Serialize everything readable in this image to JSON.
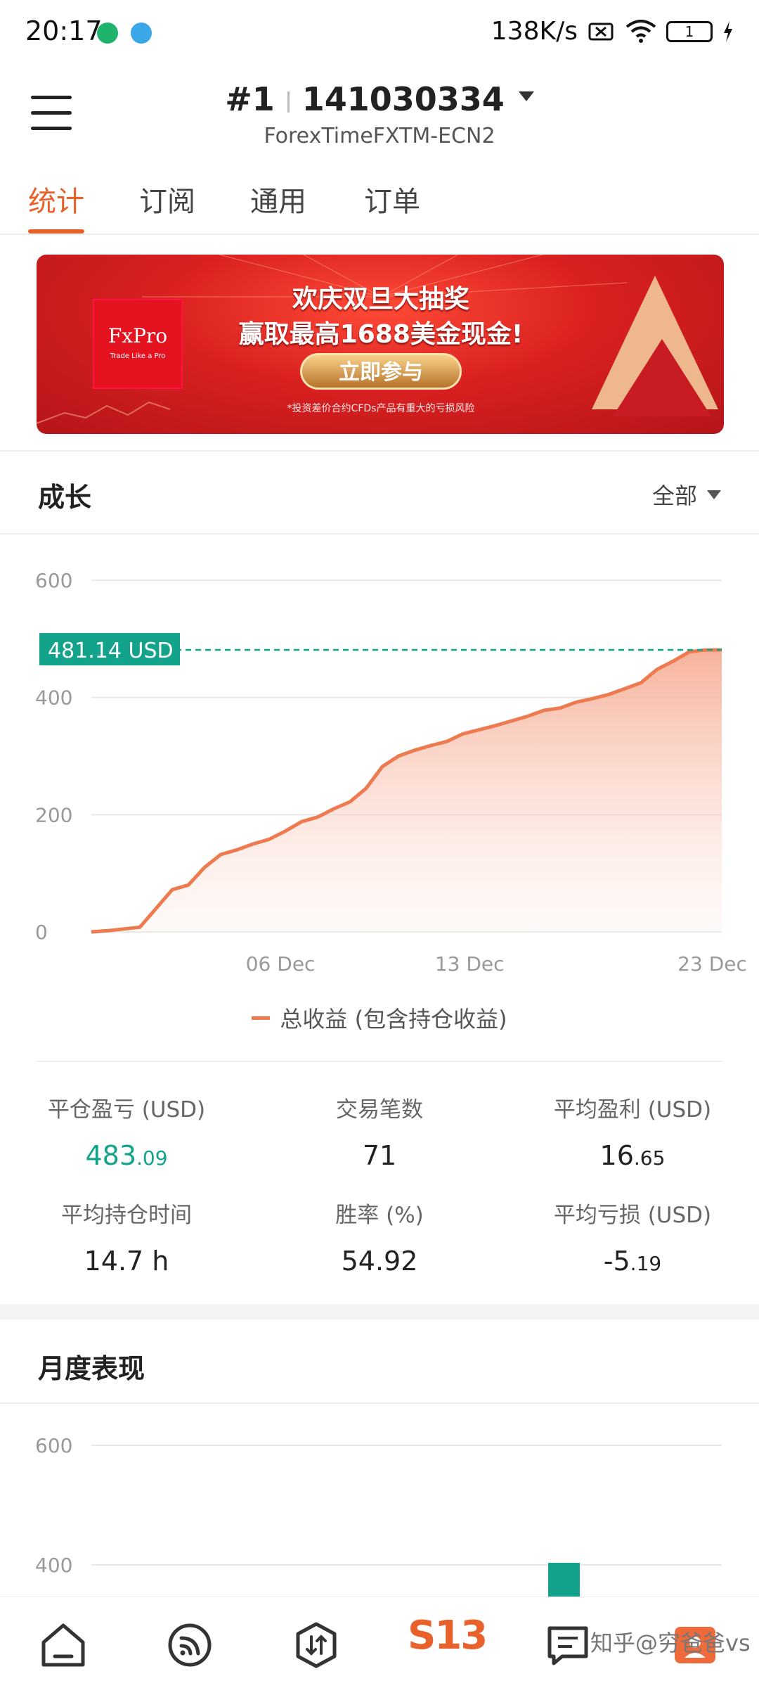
{
  "status_bar": {
    "time": "20:17",
    "speed": "138K/s",
    "battery": "1"
  },
  "header": {
    "account_prefix": "#1",
    "account_number": "141030334",
    "server": "ForexTimeFXTM-ECN2"
  },
  "tabs": [
    {
      "label": "统计",
      "active": true
    },
    {
      "label": "订阅",
      "active": false
    },
    {
      "label": "通用",
      "active": false
    },
    {
      "label": "订单",
      "active": false
    }
  ],
  "banner": {
    "logo_text": "FxPro",
    "logo_sub": "Trade Like a Pro",
    "line1": "欢庆双旦大抽奖",
    "line2": "赢取最高1688美金现金!",
    "button": "立即参与",
    "risk": "*投资差价合约CFDs产品有重大的亏损风险"
  },
  "growth": {
    "title": "成长",
    "filter": "全部",
    "legend": "总收益 (包含持仓收益)"
  },
  "chart_data": [
    {
      "type": "area",
      "ylim": [
        0,
        600
      ],
      "y_ticks": [
        "600",
        "400",
        "200",
        "0"
      ],
      "x_ticks": [
        "06 Dec",
        "13 Dec",
        "23 Dec"
      ],
      "current_value_label": "481.14 USD",
      "current_value": 481.14,
      "series": [
        {
          "name": "总收益 (包含持仓收益)",
          "values": [
            0,
            2,
            5,
            8,
            40,
            72,
            80,
            110,
            132,
            140,
            150,
            158,
            172,
            188,
            196,
            210,
            222,
            245,
            282,
            300,
            310,
            318,
            325,
            338,
            345,
            352,
            360,
            368,
            378,
            382,
            392,
            398,
            405,
            415,
            425,
            448,
            462,
            478,
            481,
            481.14
          ]
        }
      ],
      "color": "#ee7a50"
    },
    {
      "type": "bar",
      "title": "月度表现",
      "ylim": [
        360,
        600
      ],
      "y_ticks": [
        "600",
        "400"
      ],
      "visible_bar_color": "#13a38a"
    }
  ],
  "stats": [
    {
      "label": "平仓盈亏 (USD)",
      "value_int": "483",
      "value_dec": ".09",
      "green": true
    },
    {
      "label": "交易笔数",
      "value_int": "71",
      "value_dec": "",
      "green": false
    },
    {
      "label": "平均盈利 (USD)",
      "value_int": "16",
      "value_dec": ".65",
      "green": false
    },
    {
      "label": "平均持仓时间",
      "value_int": "14.7 h",
      "value_dec": "",
      "green": false
    },
    {
      "label": "胜率 (%)",
      "value_int": "54.92",
      "value_dec": "",
      "green": false
    },
    {
      "label": "平均亏损 (USD)",
      "value_int": "-5",
      "value_dec": ".19",
      "green": false
    }
  ],
  "monthly": {
    "title": "月度表现"
  },
  "bottom_nav": {
    "center_label": "S13",
    "watermark": "知乎@穷爸爸vs",
    "icons": [
      "home-icon",
      "signal-icon",
      "trade-icon",
      "s13-logo",
      "chat-icon",
      "profile-icon"
    ]
  },
  "colors": {
    "accent": "#e8612a",
    "green": "#13a38a"
  }
}
